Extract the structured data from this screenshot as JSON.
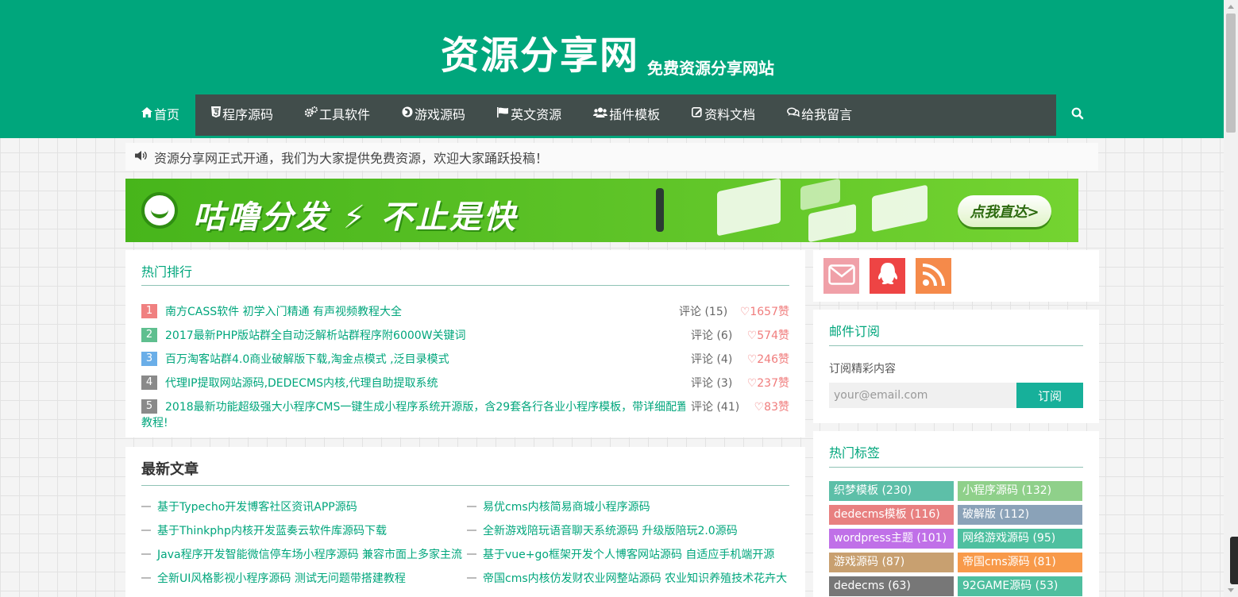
{
  "header": {
    "title": "资源分享网",
    "slogan": "免费资源分享网站"
  },
  "nav": {
    "items": [
      {
        "label": "首页",
        "icon": "home-icon"
      },
      {
        "label": "程序源码",
        "icon": "html5-icon"
      },
      {
        "label": "工具软件",
        "icon": "cogs-icon"
      },
      {
        "label": "游戏源码",
        "icon": "firefox-icon"
      },
      {
        "label": "英文资源",
        "icon": "flag-icon"
      },
      {
        "label": "插件模板",
        "icon": "users-icon"
      },
      {
        "label": "资料文档",
        "icon": "edit-icon"
      },
      {
        "label": "给我留言",
        "icon": "comments-icon"
      }
    ],
    "search_icon": "search-icon"
  },
  "notice": {
    "icon": "volume-icon",
    "text": "资源分享网正式开通，我们为大家提供免费资源，欢迎大家踊跃投稿！"
  },
  "banner": {
    "text": "咕噜分发 ⚡ 不止是快",
    "button": "点我直达>"
  },
  "hot": {
    "title": "热门排行",
    "items": [
      {
        "rank": "1",
        "title": "南方CASS软件 初学入门精通 有声视频教程大全",
        "comments": "评论 (15)",
        "likes": "♡1657赞",
        "color": "#f08080"
      },
      {
        "rank": "2",
        "title": "2017最新PHP版站群全自动泛解析站群程序附6000W关键词",
        "comments": "评论 (6)",
        "likes": "♡574赞",
        "color": "#5fbf8f"
      },
      {
        "rank": "3",
        "title": "百万淘客站群4.0商业破解版下载,淘金点模式 ,泛目录模式",
        "comments": "评论 (4)",
        "likes": "♡246赞",
        "color": "#6aaee8"
      },
      {
        "rank": "4",
        "title": "代理IP提取网站源码,DEDECMS内核,代理自助提取系统",
        "comments": "评论 (3)",
        "likes": "♡237赞",
        "color": "#8a8a8a"
      },
      {
        "rank": "5",
        "title": "2018最新功能超级强大小程序CMS一键生成小程序系统开源版，含29套各行各业小程序模板，带详细配置",
        "title_wrap": "教程!",
        "comments": "评论 (41)",
        "likes": "♡83赞",
        "color": "#8a8a8a"
      }
    ]
  },
  "latest": {
    "title": "最新文章",
    "left": [
      "基于Typecho开发博客社区资讯APP源码",
      "基于Thinkphp内核开发蓝奏云软件库源码下载",
      "Java程序开发智能微信停车场小程序源码 兼容市面上多家主流",
      "全新UI风格影视小程序源码 测试无问题带搭建教程"
    ],
    "right": [
      "易优cms内核简易商城小程序源码",
      "全新游戏陪玩语音聊天系统源码 升级版陪玩2.0源码",
      "基于vue+go框架开发个人博客网站源码 自适应手机端开源",
      "帝国cms内核仿发财农业网整站源码 农业知识养殖技术花卉大"
    ]
  },
  "social": {
    "items": [
      {
        "icon": "envelope-icon",
        "color": "#f0a0a8"
      },
      {
        "icon": "qq-icon",
        "color": "#ee4444"
      },
      {
        "icon": "rss-icon",
        "color": "#f58a4a"
      }
    ]
  },
  "subscribe": {
    "title": "邮件订阅",
    "label": "订阅精彩内容",
    "placeholder": "your@email.com",
    "button": "订阅"
  },
  "tags": {
    "title": "热门标签",
    "items": [
      {
        "label": "织梦模板 (230)",
        "color": "#5dbfa8"
      },
      {
        "label": "小程序源码 (132)",
        "color": "#8fd08a"
      },
      {
        "label": "dedecms模板 (116)",
        "color": "#e88080"
      },
      {
        "label": "破解版 (112)",
        "color": "#8aa2b8"
      },
      {
        "label": "wordpress主题 (101)",
        "color": "#c070e8"
      },
      {
        "label": "网络游戏源码 (95)",
        "color": "#4fc0a0"
      },
      {
        "label": "游戏源码 (87)",
        "color": "#c8a070"
      },
      {
        "label": "帝国cms源码 (81)",
        "color": "#f89a4a"
      },
      {
        "label": "dedecms (63)",
        "color": "#777777"
      },
      {
        "label": "92GAME源码 (53)",
        "color": "#4fbf9f"
      }
    ]
  }
}
